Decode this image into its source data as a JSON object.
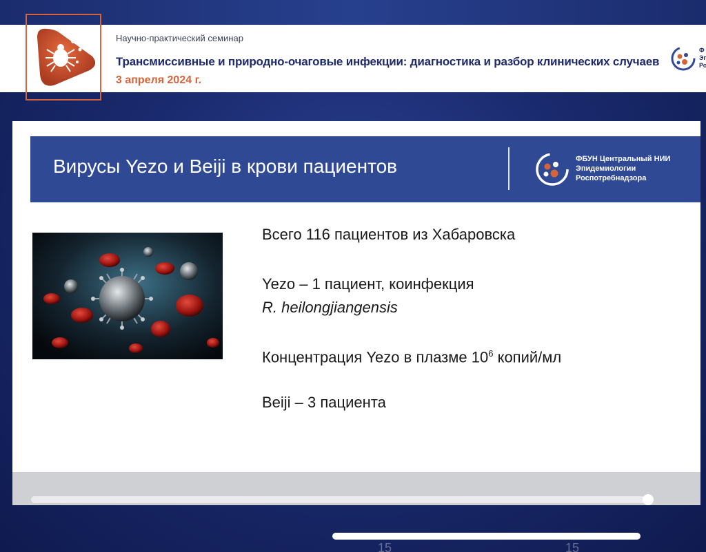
{
  "seminar": {
    "subtitle": "Научно-практический семинар",
    "title": "Трансмиссивные и природно-очаговые инфекции: диагностика и разбор клинических случаев",
    "date": "3 апреля 2024 г.",
    "corner_org_partial": [
      "Ф",
      "Эп",
      "Ро"
    ],
    "accent_color": "#d6643a",
    "title_color": "#1e2a6b"
  },
  "slide": {
    "title": "Вирусы Yezo и Beiji в крови пациентов",
    "band_color": "#2f4995",
    "org_lines": [
      "ФБУН Центральный НИИ",
      "Эпидемиологии",
      "Роспотребнадзора"
    ],
    "content": {
      "total": "Всего 116 пациентов из Хабаровска",
      "yezo_line": "Yezo – 1 пациент, коинфекция",
      "pathogen": "R. heilongjiangensis",
      "concentration_prefix": "Концентрация Yezo в плазме 10",
      "concentration_exp": "6",
      "concentration_suffix": " копий/мл",
      "beiji": "Beiji – 3 пациента"
    }
  },
  "player": {
    "progress_fraction": 0.99,
    "skip_back_label": "15",
    "skip_forward_label": "15"
  }
}
